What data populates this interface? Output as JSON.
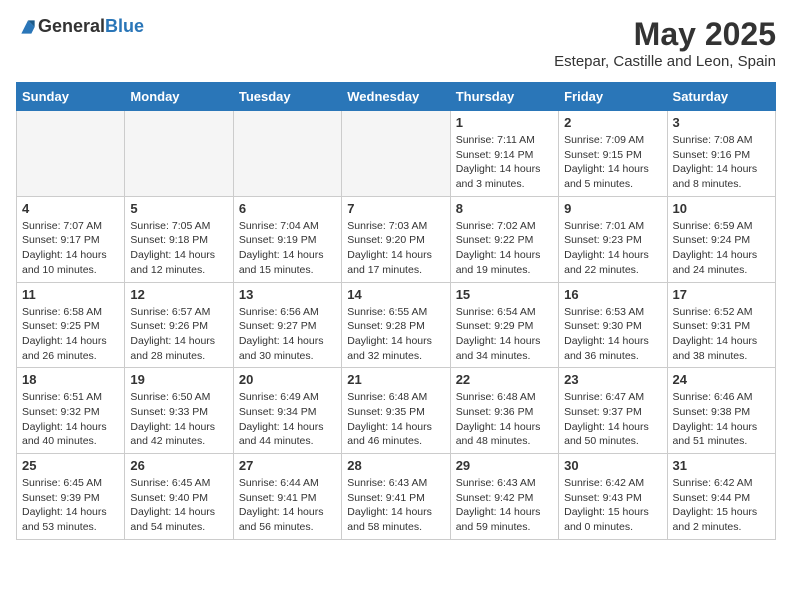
{
  "header": {
    "logo_general": "General",
    "logo_blue": "Blue",
    "title": "May 2025",
    "subtitle": "Estepar, Castille and Leon, Spain"
  },
  "days_of_week": [
    "Sunday",
    "Monday",
    "Tuesday",
    "Wednesday",
    "Thursday",
    "Friday",
    "Saturday"
  ],
  "weeks": [
    [
      {
        "num": "",
        "info": ""
      },
      {
        "num": "",
        "info": ""
      },
      {
        "num": "",
        "info": ""
      },
      {
        "num": "",
        "info": ""
      },
      {
        "num": "1",
        "info": "Sunrise: 7:11 AM\nSunset: 9:14 PM\nDaylight: 14 hours\nand 3 minutes."
      },
      {
        "num": "2",
        "info": "Sunrise: 7:09 AM\nSunset: 9:15 PM\nDaylight: 14 hours\nand 5 minutes."
      },
      {
        "num": "3",
        "info": "Sunrise: 7:08 AM\nSunset: 9:16 PM\nDaylight: 14 hours\nand 8 minutes."
      }
    ],
    [
      {
        "num": "4",
        "info": "Sunrise: 7:07 AM\nSunset: 9:17 PM\nDaylight: 14 hours\nand 10 minutes."
      },
      {
        "num": "5",
        "info": "Sunrise: 7:05 AM\nSunset: 9:18 PM\nDaylight: 14 hours\nand 12 minutes."
      },
      {
        "num": "6",
        "info": "Sunrise: 7:04 AM\nSunset: 9:19 PM\nDaylight: 14 hours\nand 15 minutes."
      },
      {
        "num": "7",
        "info": "Sunrise: 7:03 AM\nSunset: 9:20 PM\nDaylight: 14 hours\nand 17 minutes."
      },
      {
        "num": "8",
        "info": "Sunrise: 7:02 AM\nSunset: 9:22 PM\nDaylight: 14 hours\nand 19 minutes."
      },
      {
        "num": "9",
        "info": "Sunrise: 7:01 AM\nSunset: 9:23 PM\nDaylight: 14 hours\nand 22 minutes."
      },
      {
        "num": "10",
        "info": "Sunrise: 6:59 AM\nSunset: 9:24 PM\nDaylight: 14 hours\nand 24 minutes."
      }
    ],
    [
      {
        "num": "11",
        "info": "Sunrise: 6:58 AM\nSunset: 9:25 PM\nDaylight: 14 hours\nand 26 minutes."
      },
      {
        "num": "12",
        "info": "Sunrise: 6:57 AM\nSunset: 9:26 PM\nDaylight: 14 hours\nand 28 minutes."
      },
      {
        "num": "13",
        "info": "Sunrise: 6:56 AM\nSunset: 9:27 PM\nDaylight: 14 hours\nand 30 minutes."
      },
      {
        "num": "14",
        "info": "Sunrise: 6:55 AM\nSunset: 9:28 PM\nDaylight: 14 hours\nand 32 minutes."
      },
      {
        "num": "15",
        "info": "Sunrise: 6:54 AM\nSunset: 9:29 PM\nDaylight: 14 hours\nand 34 minutes."
      },
      {
        "num": "16",
        "info": "Sunrise: 6:53 AM\nSunset: 9:30 PM\nDaylight: 14 hours\nand 36 minutes."
      },
      {
        "num": "17",
        "info": "Sunrise: 6:52 AM\nSunset: 9:31 PM\nDaylight: 14 hours\nand 38 minutes."
      }
    ],
    [
      {
        "num": "18",
        "info": "Sunrise: 6:51 AM\nSunset: 9:32 PM\nDaylight: 14 hours\nand 40 minutes."
      },
      {
        "num": "19",
        "info": "Sunrise: 6:50 AM\nSunset: 9:33 PM\nDaylight: 14 hours\nand 42 minutes."
      },
      {
        "num": "20",
        "info": "Sunrise: 6:49 AM\nSunset: 9:34 PM\nDaylight: 14 hours\nand 44 minutes."
      },
      {
        "num": "21",
        "info": "Sunrise: 6:48 AM\nSunset: 9:35 PM\nDaylight: 14 hours\nand 46 minutes."
      },
      {
        "num": "22",
        "info": "Sunrise: 6:48 AM\nSunset: 9:36 PM\nDaylight: 14 hours\nand 48 minutes."
      },
      {
        "num": "23",
        "info": "Sunrise: 6:47 AM\nSunset: 9:37 PM\nDaylight: 14 hours\nand 50 minutes."
      },
      {
        "num": "24",
        "info": "Sunrise: 6:46 AM\nSunset: 9:38 PM\nDaylight: 14 hours\nand 51 minutes."
      }
    ],
    [
      {
        "num": "25",
        "info": "Sunrise: 6:45 AM\nSunset: 9:39 PM\nDaylight: 14 hours\nand 53 minutes."
      },
      {
        "num": "26",
        "info": "Sunrise: 6:45 AM\nSunset: 9:40 PM\nDaylight: 14 hours\nand 54 minutes."
      },
      {
        "num": "27",
        "info": "Sunrise: 6:44 AM\nSunset: 9:41 PM\nDaylight: 14 hours\nand 56 minutes."
      },
      {
        "num": "28",
        "info": "Sunrise: 6:43 AM\nSunset: 9:41 PM\nDaylight: 14 hours\nand 58 minutes."
      },
      {
        "num": "29",
        "info": "Sunrise: 6:43 AM\nSunset: 9:42 PM\nDaylight: 14 hours\nand 59 minutes."
      },
      {
        "num": "30",
        "info": "Sunrise: 6:42 AM\nSunset: 9:43 PM\nDaylight: 15 hours\nand 0 minutes."
      },
      {
        "num": "31",
        "info": "Sunrise: 6:42 AM\nSunset: 9:44 PM\nDaylight: 15 hours\nand 2 minutes."
      }
    ]
  ]
}
